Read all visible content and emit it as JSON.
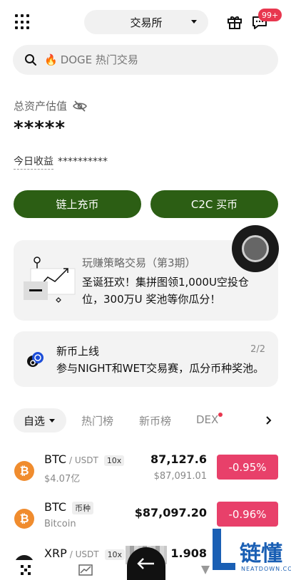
{
  "header": {
    "exchange_label": "交易所",
    "badge": "99+"
  },
  "search": {
    "placeholder": "DOGE 热门交易",
    "fire_icon": "🔥"
  },
  "assets": {
    "label": "总资产估值",
    "value": "*****",
    "today_label": "今日收益",
    "today_value": "**********"
  },
  "actions": {
    "deposit": "链上充币",
    "c2c": "C2C 买币"
  },
  "promo": {
    "title": "玩赚策略交易（第3期）",
    "text": "圣诞狂欢！集拼图领1,000U空投仓位，300万U 奖池等你瓜分！"
  },
  "news": {
    "title": "新币上线",
    "pager": "2/2",
    "text": "参与NIGHT和WET交易赛，瓜分币种奖池。"
  },
  "tabs": {
    "active": "自选",
    "items": [
      "热门榜",
      "新币榜",
      "DEX"
    ]
  },
  "rows": [
    {
      "symbol": "BTC",
      "pair": "/ USDT",
      "tag": "10x",
      "sub": "$4.07亿",
      "price": "87,127.6",
      "price_sub": "$87,091.01",
      "change": "-0.95%",
      "icon_text": "₿"
    },
    {
      "symbol": "BTC",
      "pair": "",
      "tag": "币种",
      "sub": "Bitcoin",
      "price": "$87,097.20",
      "price_sub": "",
      "change": "-0.96%",
      "icon_text": "₿"
    },
    {
      "symbol": "XRP",
      "pair": "/ USDT",
      "tag": "10x",
      "sub": "",
      "price": "1.908",
      "price_sub": "",
      "change": "",
      "icon_text": "✕"
    }
  ],
  "watermark": {
    "text": "链懂",
    "sub": "NEATDOWN.COM"
  },
  "colors": {
    "primary_green": "#2c5e14",
    "down_red": "#e8406a",
    "badge_red": "#e8374f"
  }
}
